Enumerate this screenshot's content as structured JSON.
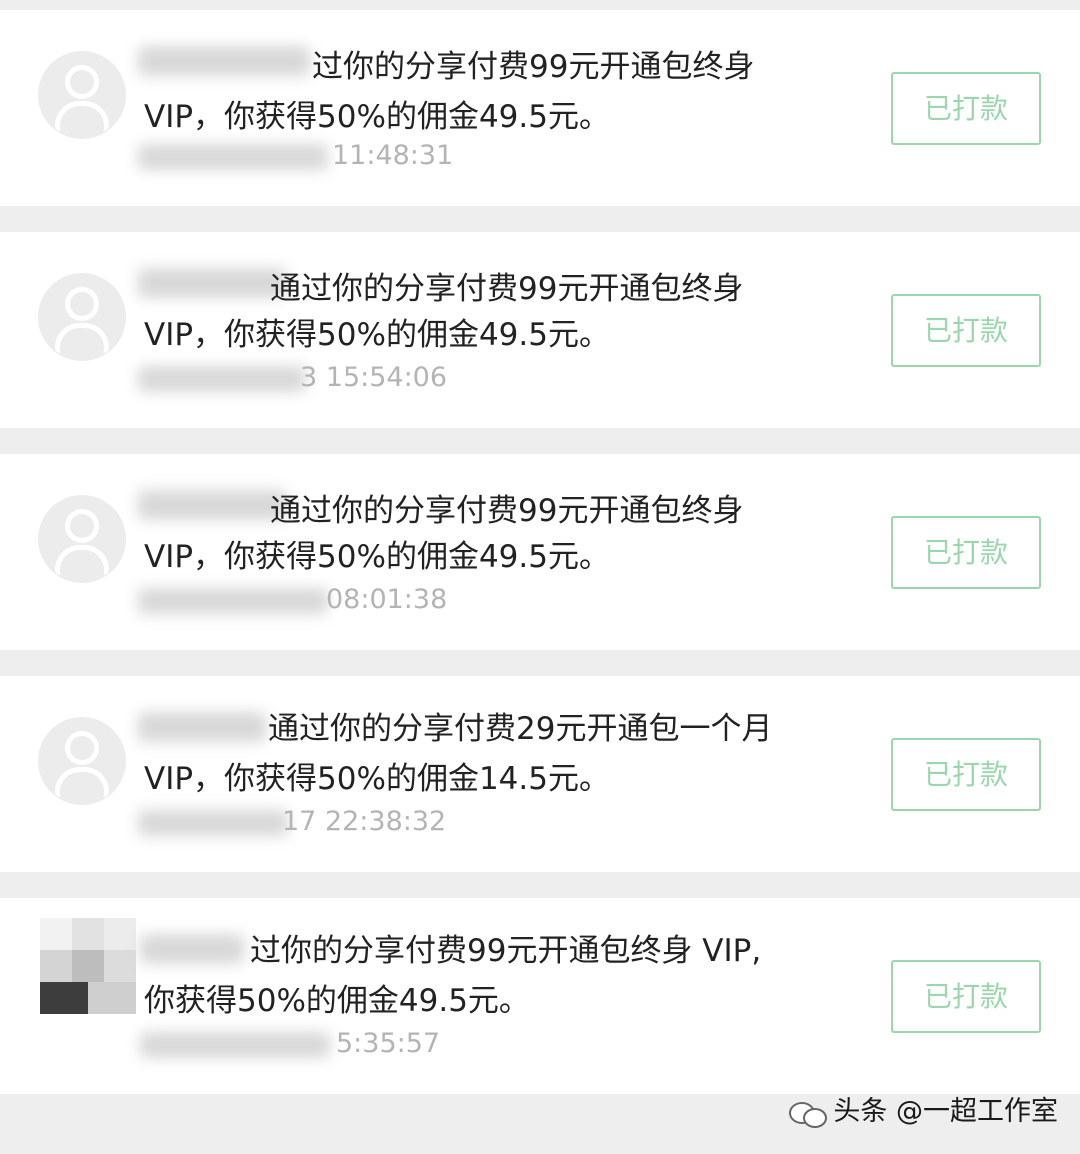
{
  "colors": {
    "page_background": "#eeeeee",
    "card_background": "#ffffff",
    "paid_button_green": "#9ad7ad",
    "message_text": "#222222",
    "timestamp_text": "#b4b4b4"
  },
  "records": [
    {
      "message_line1": "过你的分享付费99元开通包终身",
      "message_line2": "VIP，你获得50%的佣金49.5元。",
      "time": "11:48:31",
      "button_label": "已打款"
    },
    {
      "message_line1": "通过你的分享付费99元开通包终身",
      "message_line2": "VIP，你获得50%的佣金49.5元。",
      "time": "3 15:54:06",
      "button_label": "已打款"
    },
    {
      "message_line1": "通过你的分享付费99元开通包终身",
      "message_line2": "VIP，你获得50%的佣金49.5元。",
      "time": "08:01:38",
      "button_label": "已打款"
    },
    {
      "message_line1": "通过你的分享付费29元开通包一个月",
      "message_line2": "VIP，你获得50%的佣金14.5元。",
      "time": "17 22:38:32",
      "button_label": "已打款"
    },
    {
      "message_line1": "过你的分享付费99元开通包终身 VIP,",
      "message_line2": "你获得50%的佣金49.5元。",
      "time": "5:35:57",
      "button_label": "已打款"
    }
  ],
  "watermark": {
    "text": "头条 @一超工作室",
    "icon": "wechat-icon"
  }
}
